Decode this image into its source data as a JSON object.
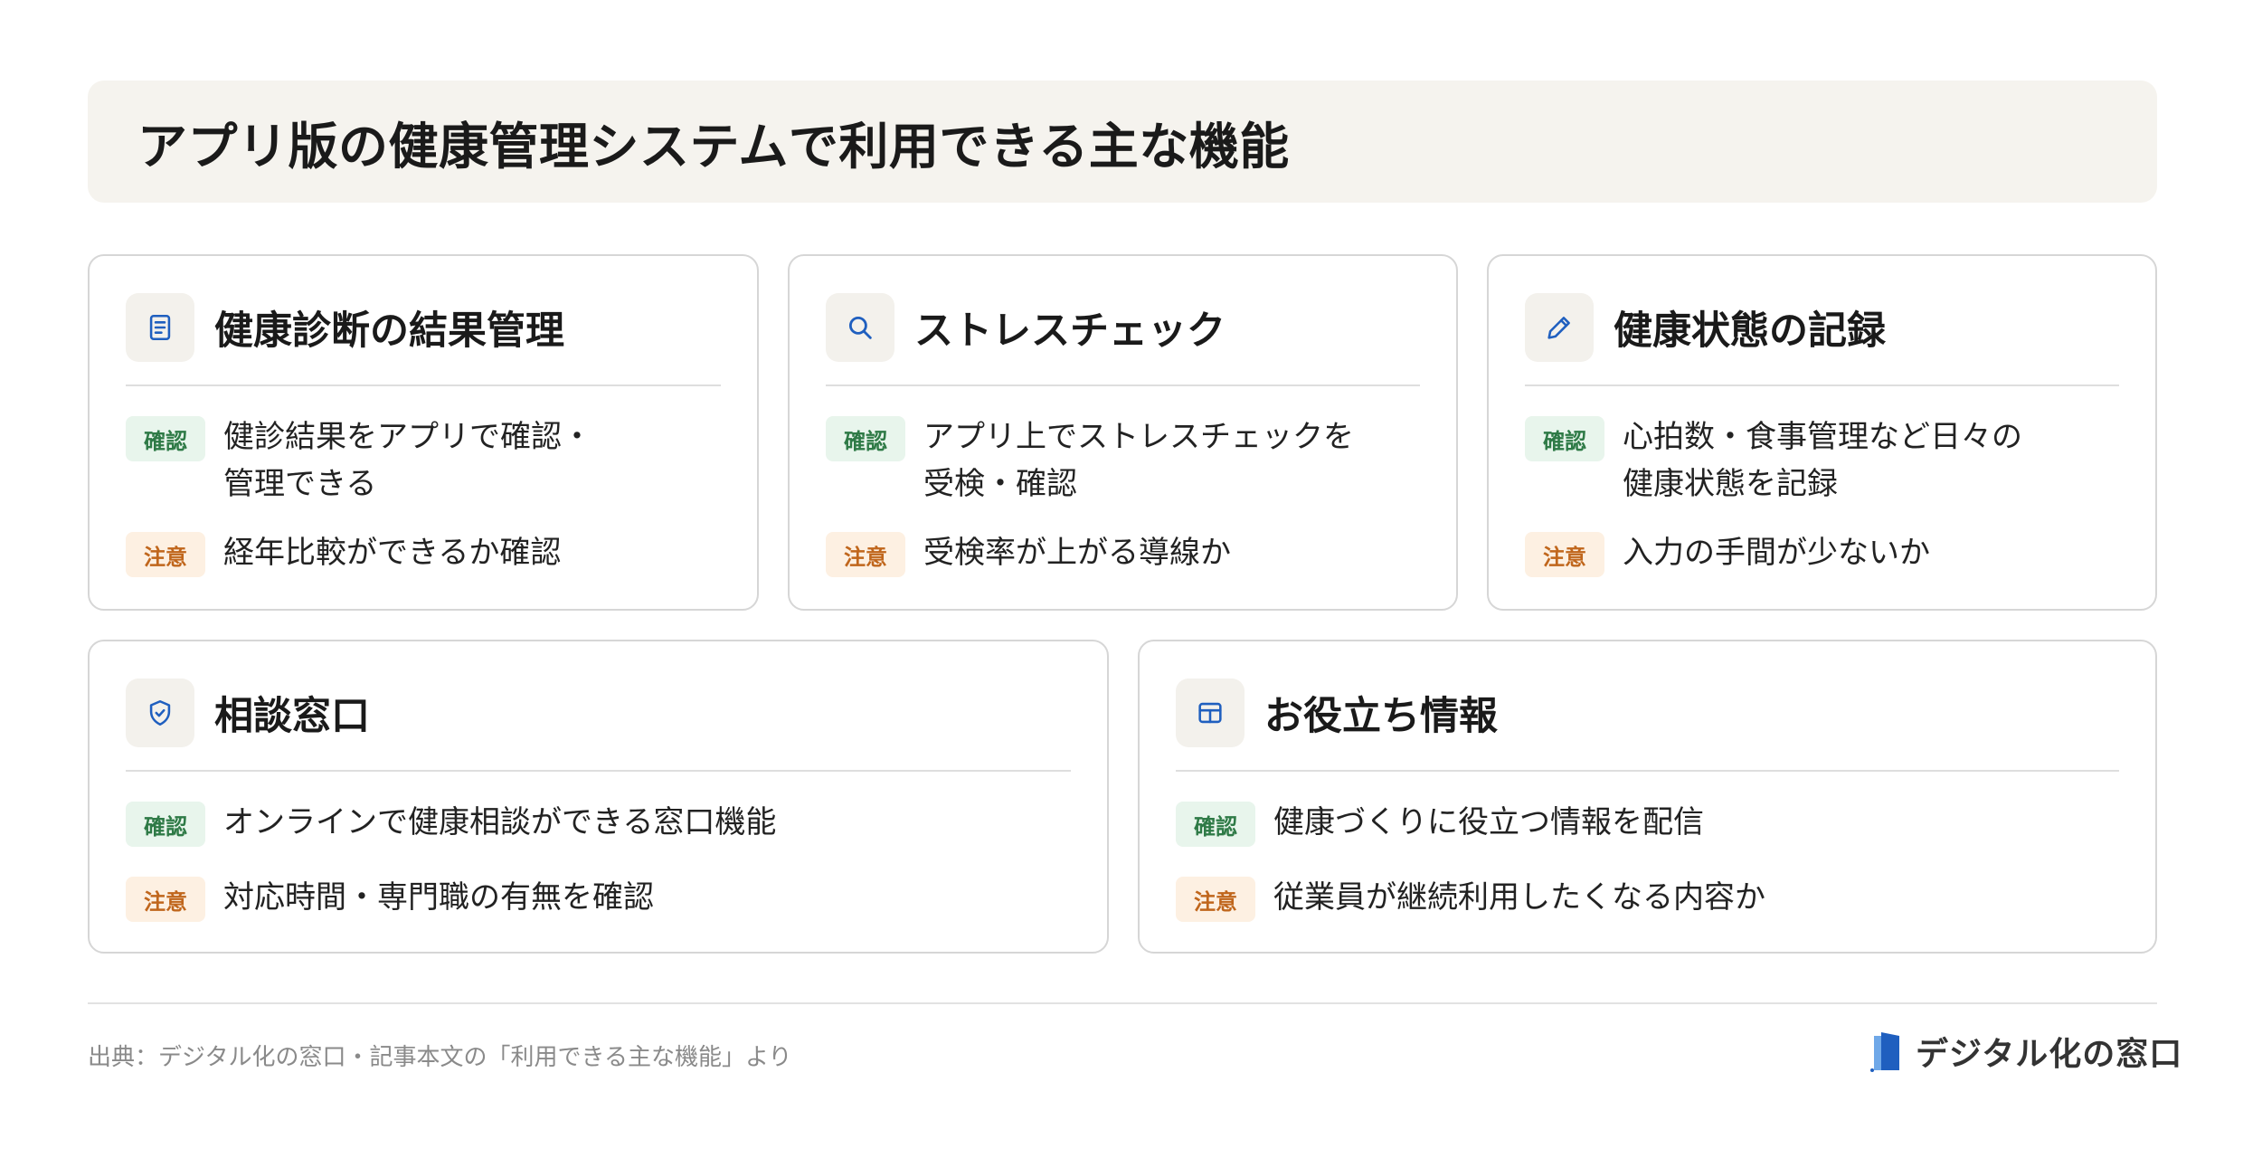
{
  "header": {
    "title": "アプリ版の健康管理システムで利用できる主な機能"
  },
  "cards": [
    {
      "title": "健康診断の結果管理",
      "icon": "document-icon",
      "check_badge": "確認",
      "check_lines": [
        "健診結果をアプリで確認・",
        "管理できる"
      ],
      "note_badge": "注意",
      "note_text": "経年比較ができるか確認"
    },
    {
      "title": "ストレスチェック",
      "icon": "search-icon",
      "check_badge": "確認",
      "check_lines": [
        "アプリ上でストレスチェックを",
        "受検・確認"
      ],
      "note_badge": "注意",
      "note_text": "受検率が上がる導線か"
    },
    {
      "title": "健康状態の記録",
      "icon": "pencil-icon",
      "check_badge": "確認",
      "check_lines": [
        "心拍数・食事管理など日々の",
        "健康状態を記録"
      ],
      "note_badge": "注意",
      "note_text": "入力の手間が少ないか"
    },
    {
      "title": "相談窓口",
      "icon": "shield-check-icon",
      "check_badge": "確認",
      "check_text": "オンラインで健康相談ができる窓口機能",
      "note_badge": "注意",
      "note_text": "対応時間・専門職の有無を確認"
    },
    {
      "title": "お役立ち情報",
      "icon": "grid-icon",
      "check_badge": "確認",
      "check_text": "健康づくりに役立つ情報を配信",
      "note_badge": "注意",
      "note_text": "従業員が継続利用したくなる内容か"
    }
  ],
  "footer": {
    "source": "出典：デジタル化の窓口・記事本文の「利用できる主な機能」より",
    "brand": "デジタル化の窓口"
  },
  "colors": {
    "accent_blue": "#1f5fbf",
    "check_green": "#2e7a46",
    "note_orange": "#c0661c",
    "title_bg": "#f5f3ee"
  }
}
